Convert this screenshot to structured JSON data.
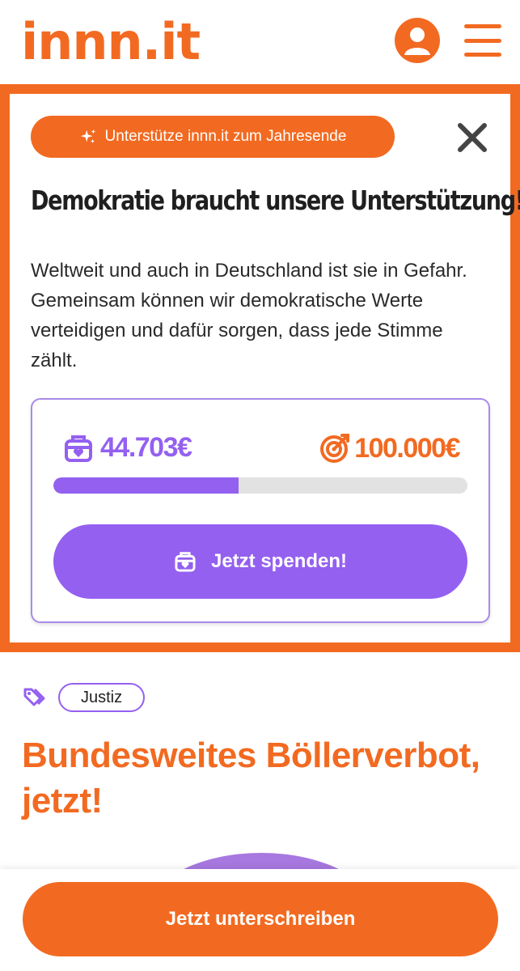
{
  "header": {
    "logo_text": "innn.it",
    "icons": [
      "user-icon",
      "hamburger-menu-icon"
    ]
  },
  "modal": {
    "badge_label": "Unterstütze innn.it zum Jahresende",
    "title": "Demokratie braucht unsere Unterstützung!",
    "text": "Weltweit und auch in Deutschland ist sie in Gefahr. Gemeinsam können wir demokratische Werte verteidigen und dafür sorgen, dass jede Stimme zählt.",
    "raised_amount": "44.703€",
    "goal_amount": "100.000€",
    "progress_fraction": 0.447,
    "donate_label": "Jetzt spenden!"
  },
  "page": {
    "tag": "Justiz",
    "title": "Bundesweites Böllerverbot, jetzt!"
  },
  "bottom": {
    "sign_label": "Jetzt unterschreiben"
  },
  "colors": {
    "brand_orange": "#f26a21",
    "brand_purple": "#9460f0",
    "progress_track": "#e2e2e2"
  }
}
